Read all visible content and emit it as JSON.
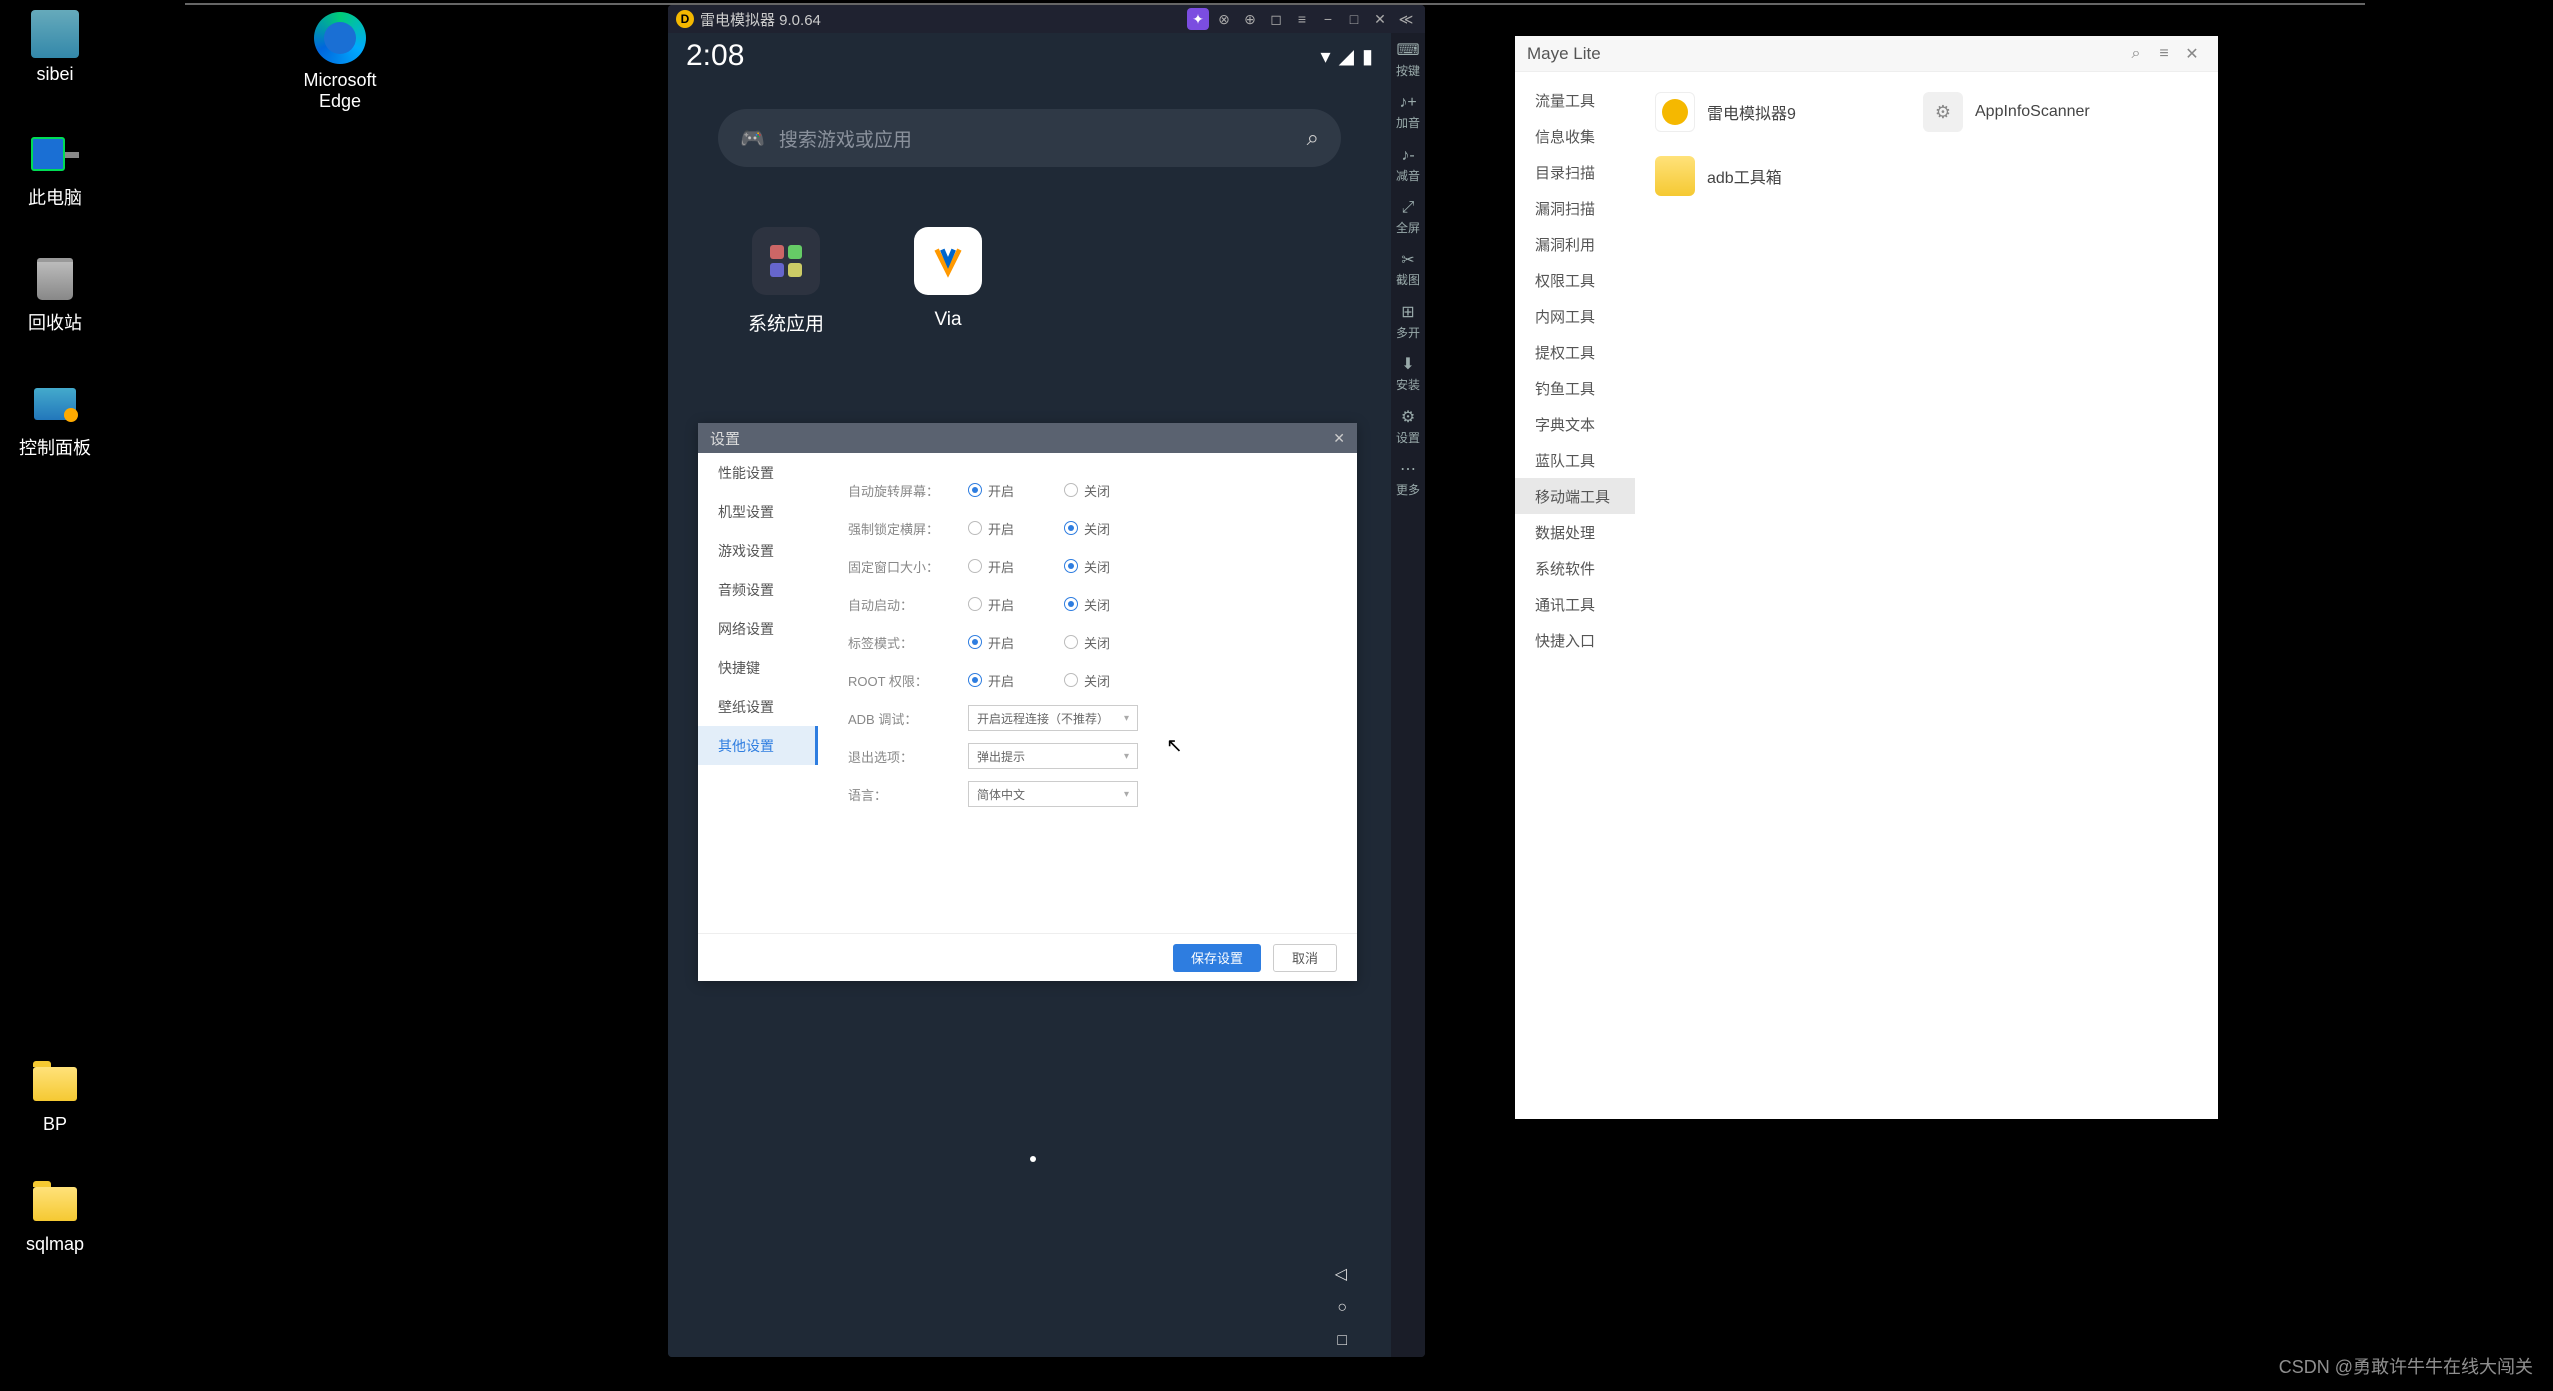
{
  "desktop": {
    "icons": [
      {
        "label": "sibei"
      },
      {
        "label": "此电脑"
      },
      {
        "label": "回收站"
      },
      {
        "label": "控制面板"
      },
      {
        "label": "BP"
      },
      {
        "label": "sqlmap"
      }
    ],
    "edge_label": "Microsoft\nEdge"
  },
  "emulator": {
    "title": "雷电模拟器 9.0.64",
    "status_time": "2:08",
    "search_placeholder": "搜索游戏或应用",
    "apps": [
      {
        "name": "系统应用"
      },
      {
        "name": "Via"
      }
    ],
    "side_tools": [
      {
        "icon": "⌨",
        "label": "按键"
      },
      {
        "icon": "♪+",
        "label": "加音"
      },
      {
        "icon": "♪-",
        "label": "减音"
      },
      {
        "icon": "⤢",
        "label": "全屏"
      },
      {
        "icon": "✂",
        "label": "截图"
      },
      {
        "icon": "⊞",
        "label": "多开"
      },
      {
        "icon": "⬇",
        "label": "安装"
      },
      {
        "icon": "⚙",
        "label": "设置"
      },
      {
        "icon": "⋯",
        "label": "更多"
      }
    ],
    "nav_buttons": [
      "◁",
      "○",
      "□"
    ]
  },
  "settings": {
    "title": "设置",
    "nav": [
      "性能设置",
      "机型设置",
      "游戏设置",
      "音频设置",
      "网络设置",
      "快捷键",
      "壁纸设置",
      "其他设置"
    ],
    "active_nav": "其他设置",
    "radio_rows": [
      {
        "label": "自动旋转屏幕：",
        "value": "开启"
      },
      {
        "label": "强制锁定横屏：",
        "value": "关闭"
      },
      {
        "label": "固定窗口大小：",
        "value": "关闭"
      },
      {
        "label": "自动启动：",
        "value": "关闭"
      },
      {
        "label": "标签模式：",
        "value": "开启"
      },
      {
        "label": "ROOT 权限：",
        "value": "开启"
      }
    ],
    "opt_on": "开启",
    "opt_off": "关闭",
    "dropdowns": [
      {
        "label": "ADB 调试：",
        "value": "开启远程连接（不推荐）"
      },
      {
        "label": "退出选项：",
        "value": "弹出提示"
      },
      {
        "label": "语言：",
        "value": "简体中文"
      }
    ],
    "save": "保存设置",
    "cancel": "取消"
  },
  "maye": {
    "title": "Maye Lite",
    "nav": [
      "流量工具",
      "信息收集",
      "目录扫描",
      "漏洞扫描",
      "漏洞利用",
      "权限工具",
      "内网工具",
      "提权工具",
      "钓鱼工具",
      "字典文本",
      "蓝队工具",
      "移动端工具",
      "数据处理",
      "系统软件",
      "通讯工具",
      "快捷入口"
    ],
    "active_nav": "移动端工具",
    "items": [
      {
        "icon": "y",
        "label": "雷电模拟器9"
      },
      {
        "icon": "g",
        "label": "AppInfoScanner"
      },
      {
        "icon": "f",
        "label": "adb工具箱"
      }
    ]
  },
  "watermark": "CSDN @勇敢许牛牛在线大闯关"
}
